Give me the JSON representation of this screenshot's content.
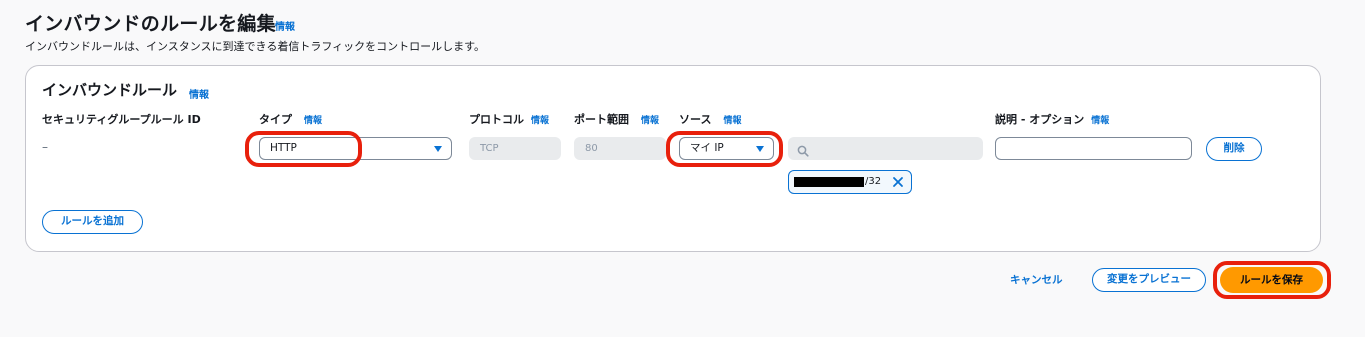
{
  "header": {
    "title": "インバウンドのルールを編集",
    "info": "情報",
    "description": "インバウンドルールは、インスタンスに到達できる着信トラフィックをコントロールします。"
  },
  "panel": {
    "title": "インバウンドルール",
    "info": "情報",
    "columns": {
      "rule_id": "セキュリティグループルール ID",
      "type": "タイプ",
      "protocol": "プロトコル",
      "port_range": "ポート範囲",
      "source": "ソース",
      "description": "説明 - オプション"
    },
    "info_label": "情報",
    "row": {
      "rule_id": "–",
      "type": "HTTP",
      "protocol": "TCP",
      "port_range": "80",
      "source": "マイ IP",
      "source_search_placeholder": "",
      "cidr_suffix": "/32",
      "description": "",
      "delete_label": "削除"
    },
    "add_rule_label": "ルールを追加"
  },
  "footer": {
    "cancel_label": "キャンセル",
    "preview_label": "変更をプレビュー",
    "save_label": "ルールを保存"
  },
  "icons": {
    "search": "search-icon",
    "close": "close-icon",
    "caret": "caret-down-icon"
  },
  "colors": {
    "accent": "#0972d3",
    "primary_button": "#ff9900",
    "highlight": "#e8200c"
  }
}
